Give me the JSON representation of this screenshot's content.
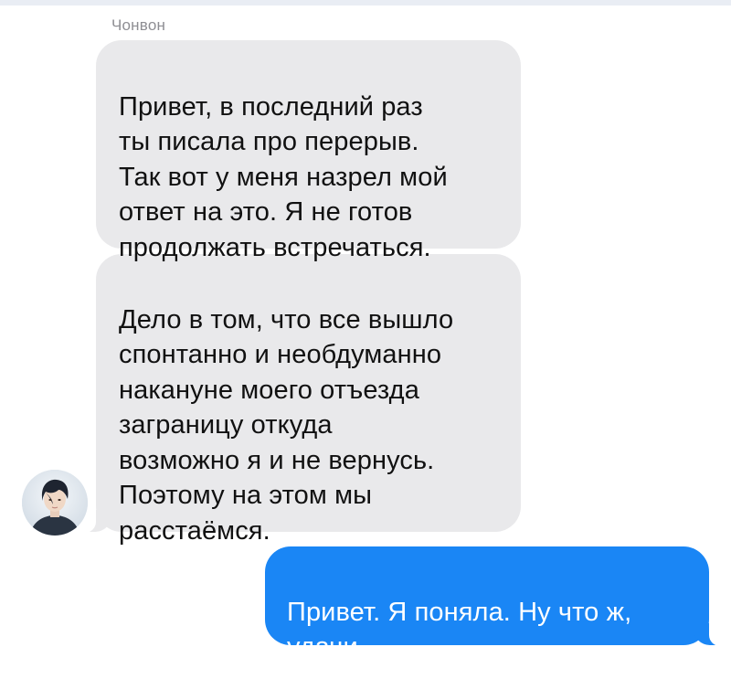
{
  "conversation": {
    "sender_name": "Чонвон",
    "messages": [
      {
        "direction": "incoming",
        "text": "Привет, в последний раз\nты писала про перерыв.\nТак вот у меня назрел мой\nответ на это. Я не готов\nпродолжать встречаться."
      },
      {
        "direction": "incoming",
        "text": "Дело в том, что все вышло\nспонтанно и необдуманно\nнакануне моего отъезда\nзаграницу откуда\nвозможно я и не вернусь.\nПоэтому на этом мы\nрасстаёмся."
      },
      {
        "direction": "outgoing",
        "text": "Привет. Я поняла. Ну что ж,\nудачи."
      }
    ]
  },
  "colors": {
    "incoming_bubble": "#e9e9eb",
    "outgoing_bubble": "#1a86f5",
    "sender_name": "#8e8e93"
  },
  "icons": {
    "avatar": "contact-avatar-photo"
  }
}
